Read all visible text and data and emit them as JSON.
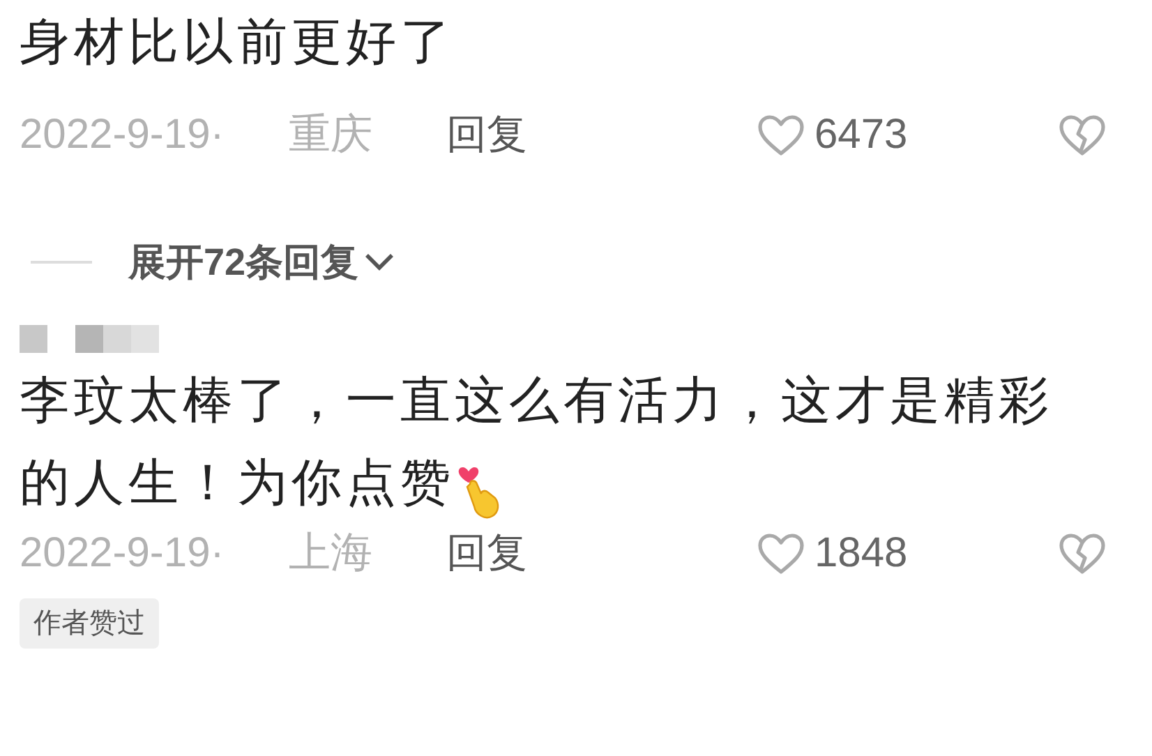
{
  "comments": [
    {
      "text": "身材比以前更好了",
      "date": "2022-9-19·",
      "location": "重庆",
      "reply": "回复",
      "likes": "6473",
      "expand": "展开72条回复"
    },
    {
      "username_blurred": true,
      "text": "李玟太棒了，一直这么有活力，这才是精彩的人生！为你点赞",
      "finger_heart_emoji": true,
      "date": "2022-9-19·",
      "location": "上海",
      "reply": "回复",
      "likes": "1848",
      "badge": "作者赞过"
    }
  ]
}
